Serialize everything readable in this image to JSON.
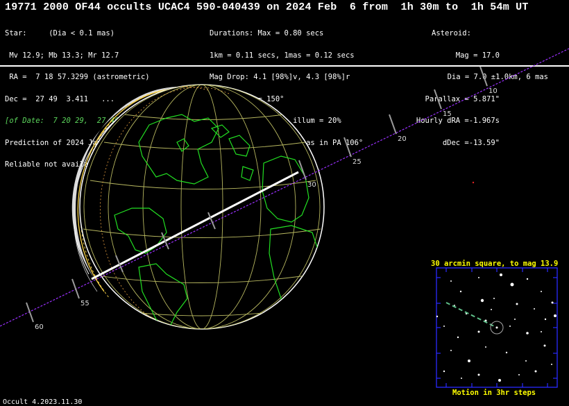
{
  "title": "19771 2000 OF44 occults UCAC4 590-040439 on 2024 Feb  6 from  1h 30m to  1h 54m UT",
  "star": [
    "Star:     (Dia < 0.1 mas)",
    " Mv 12.9; Mb 13.3; Mr 12.7",
    " RA =  7 18 57.3299 (astrometric)",
    "Dec =  27 49  3.411   ...",
    "[of Date:  7 20 29,  27 46 26]",
    "Prediction of 2024 Jan 21.0",
    "Reliable not available"
  ],
  "event": [
    "Durations: Max = 0.80 secs",
    "1km = 0.11 secs, 1mas = 0.12 secs",
    "Mag Drop: 4.1 [98%]v, 4.3 [98%]r",
    "Sun : Dist = 150°",
    "Moon: Dist = 157°, illum = 20%",
    "1σ Err: ±(1.0 x 0.0) mas in PA 106°"
  ],
  "asteroid": [
    "Asteroid:",
    "Mag = 17.0",
    "Dia = 7.0 ±1.0km, 6 mas",
    "Parallax = 5.871\"",
    "Hourly dRA =-1.967s",
    "dDec =-13.59\""
  ],
  "path_ticks": [
    "10",
    "15",
    "20",
    "25",
    "30",
    "55",
    "60"
  ],
  "inset": {
    "title": "30 arcmin square, to mag 13.9",
    "footer": "Motion in 3hr steps"
  },
  "footer": "Occult 4.2023.11.30",
  "colors": {
    "coast": "#22e022",
    "grid": "#b8b860",
    "path": "#9b30ff",
    "inset_border": "#2a2aff",
    "inset_text": "#ffff00"
  }
}
